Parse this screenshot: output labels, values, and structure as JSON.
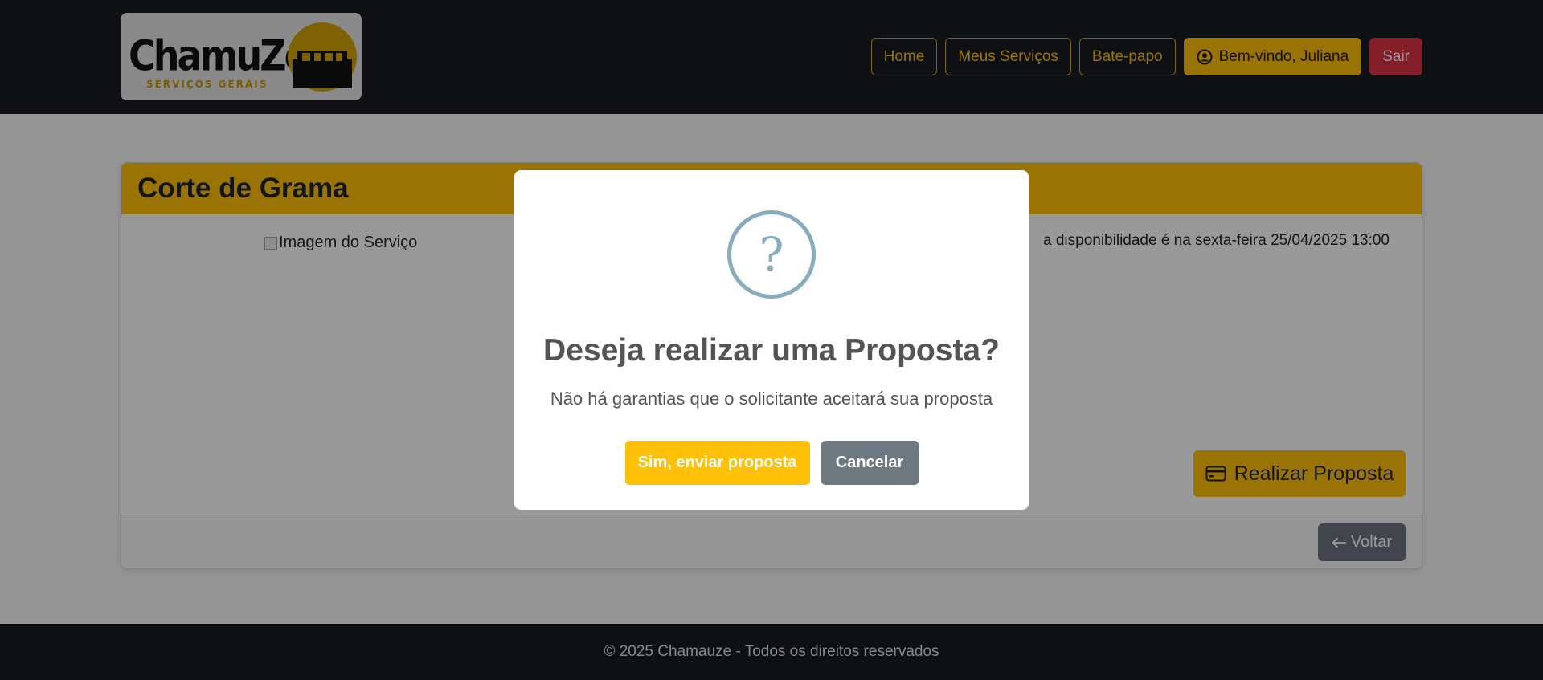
{
  "brand": {
    "name": "ChamuZé",
    "tagline": "SERVIÇOS GERAIS"
  },
  "nav": {
    "home": "Home",
    "my_services": "Meus Serviços",
    "chat": "Bate-papo",
    "welcome": "Bem-vindo, Juliana",
    "logout": "Sair"
  },
  "service": {
    "title": "Corte de Grama",
    "image_alt": "Imagem do Serviço",
    "availability": "a disponibilidade é na sexta-feira 25/04/2025 13:00",
    "proposal_button": "Realizar Proposta",
    "back_button": "Voltar"
  },
  "modal": {
    "icon": "?",
    "title": "Deseja realizar uma Proposta?",
    "text": "Não há garantias que o solicitante aceitará sua proposta",
    "confirm": "Sim, enviar proposta",
    "cancel": "Cancelar"
  },
  "footer": {
    "text": "© 2025 Chamauze - Todos os direitos reservados"
  },
  "colors": {
    "accent": "#ffc107",
    "danger": "#dc3545",
    "secondary": "#6c757d",
    "dark": "#191b22",
    "question_icon": "#87adbd"
  }
}
